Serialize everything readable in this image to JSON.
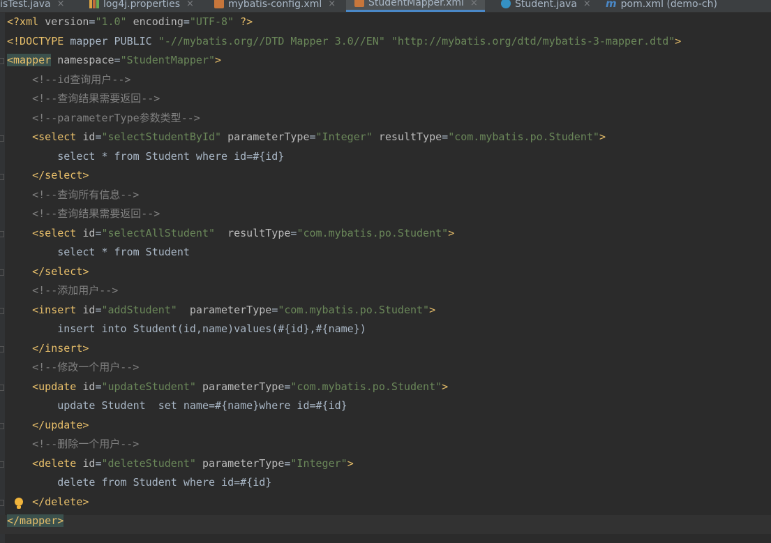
{
  "tabs": [
    {
      "label": "atisTest.java",
      "icon": "java-class-icon",
      "active": false
    },
    {
      "label": "log4j.properties",
      "icon": "properties-file-icon",
      "active": false
    },
    {
      "label": "mybatis-config.xml",
      "icon": "xml-file-icon",
      "active": false
    },
    {
      "label": "StudentMapper.xml",
      "icon": "xml-file-icon",
      "active": true
    },
    {
      "label": "Student.java",
      "icon": "java-class-icon",
      "active": false
    },
    {
      "label": "pom.xml (demo-ch)",
      "icon": "maven-icon",
      "active": false
    }
  ],
  "tab_close_glyph": "×",
  "colors": {
    "background": "#2b2b2b",
    "tag": "#e8bf6a",
    "attribute": "#bababa",
    "string": "#6a8759",
    "comment": "#808080",
    "text": "#a9b7c6",
    "matched_tag_highlight": "#3b514d"
  },
  "editor": {
    "lines": [
      [
        {
          "t": "<?xml ",
          "c": "pi"
        },
        {
          "t": "version",
          "c": "attr"
        },
        {
          "t": "=",
          "c": "text"
        },
        {
          "t": "\"1.0\"",
          "c": "val"
        },
        {
          "t": " ",
          "c": "text"
        },
        {
          "t": "encoding",
          "c": "attr"
        },
        {
          "t": "=",
          "c": "text"
        },
        {
          "t": "\"UTF-8\"",
          "c": "val"
        },
        {
          "t": " ?>",
          "c": "pi"
        }
      ],
      [
        {
          "t": "<!DOCTYPE ",
          "c": "doctype"
        },
        {
          "t": "mapper PUBLIC ",
          "c": "text"
        },
        {
          "t": "\"-//mybatis.org//DTD Mapper 3.0//EN\"",
          "c": "val"
        },
        {
          "t": " ",
          "c": "text"
        },
        {
          "t": "\"http://mybatis.org/dtd/mybatis-3-mapper.dtd\"",
          "c": "val"
        },
        {
          "t": ">",
          "c": "doctype"
        }
      ],
      [
        {
          "t": "<mapper",
          "c": "tag",
          "hl": true
        },
        {
          "t": " ",
          "c": "text"
        },
        {
          "t": "namespace",
          "c": "attr"
        },
        {
          "t": "=",
          "c": "text"
        },
        {
          "t": "\"StudentMapper\"",
          "c": "val"
        },
        {
          "t": ">",
          "c": "tag"
        }
      ],
      [
        {
          "t": "    <!--id查询用户-->",
          "c": "comment"
        }
      ],
      [
        {
          "t": "    <!--查询结果需要返回-->",
          "c": "comment"
        }
      ],
      [
        {
          "t": "    <!--parameterType参数类型-->",
          "c": "comment"
        }
      ],
      [
        {
          "t": "    ",
          "c": "text"
        },
        {
          "t": "<select",
          "c": "tag"
        },
        {
          "t": " ",
          "c": "text"
        },
        {
          "t": "id",
          "c": "attr"
        },
        {
          "t": "=",
          "c": "text"
        },
        {
          "t": "\"selectStudentById\"",
          "c": "val"
        },
        {
          "t": " ",
          "c": "text"
        },
        {
          "t": "parameterType",
          "c": "attr"
        },
        {
          "t": "=",
          "c": "text"
        },
        {
          "t": "\"Integer\"",
          "c": "val"
        },
        {
          "t": " ",
          "c": "text"
        },
        {
          "t": "resultType",
          "c": "attr"
        },
        {
          "t": "=",
          "c": "text"
        },
        {
          "t": "\"com.mybatis.po.Student\"",
          "c": "val"
        },
        {
          "t": ">",
          "c": "tag"
        }
      ],
      [
        {
          "t": "        select * from Student where id=#{id}",
          "c": "text"
        }
      ],
      [
        {
          "t": "    ",
          "c": "text"
        },
        {
          "t": "</select>",
          "c": "tag"
        }
      ],
      [
        {
          "t": "    <!--查询所有信息-->",
          "c": "comment"
        }
      ],
      [
        {
          "t": "    <!--查询结果需要返回-->",
          "c": "comment"
        }
      ],
      [
        {
          "t": "    ",
          "c": "text"
        },
        {
          "t": "<select",
          "c": "tag"
        },
        {
          "t": " ",
          "c": "text"
        },
        {
          "t": "id",
          "c": "attr"
        },
        {
          "t": "=",
          "c": "text"
        },
        {
          "t": "\"selectAllStudent\"",
          "c": "val"
        },
        {
          "t": "  ",
          "c": "text"
        },
        {
          "t": "resultType",
          "c": "attr"
        },
        {
          "t": "=",
          "c": "text"
        },
        {
          "t": "\"com.mybatis.po.Student\"",
          "c": "val"
        },
        {
          "t": ">",
          "c": "tag"
        }
      ],
      [
        {
          "t": "        select * from Student",
          "c": "text"
        }
      ],
      [
        {
          "t": "    ",
          "c": "text"
        },
        {
          "t": "</select>",
          "c": "tag"
        }
      ],
      [
        {
          "t": "    <!--添加用户-->",
          "c": "comment"
        }
      ],
      [
        {
          "t": "    ",
          "c": "text"
        },
        {
          "t": "<insert",
          "c": "tag"
        },
        {
          "t": " ",
          "c": "text"
        },
        {
          "t": "id",
          "c": "attr"
        },
        {
          "t": "=",
          "c": "text"
        },
        {
          "t": "\"addStudent\"",
          "c": "val"
        },
        {
          "t": "  ",
          "c": "text"
        },
        {
          "t": "parameterType",
          "c": "attr"
        },
        {
          "t": "=",
          "c": "text"
        },
        {
          "t": "\"com.mybatis.po.Student\"",
          "c": "val"
        },
        {
          "t": ">",
          "c": "tag"
        }
      ],
      [
        {
          "t": "        insert into Student(id,name)values(#{id},#{name})",
          "c": "text"
        }
      ],
      [
        {
          "t": "    ",
          "c": "text"
        },
        {
          "t": "</insert>",
          "c": "tag"
        }
      ],
      [
        {
          "t": "    <!--修改一个用户-->",
          "c": "comment"
        }
      ],
      [
        {
          "t": "    ",
          "c": "text"
        },
        {
          "t": "<update",
          "c": "tag"
        },
        {
          "t": " ",
          "c": "text"
        },
        {
          "t": "id",
          "c": "attr"
        },
        {
          "t": "=",
          "c": "text"
        },
        {
          "t": "\"updateStudent\"",
          "c": "val"
        },
        {
          "t": " ",
          "c": "text"
        },
        {
          "t": "parameterType",
          "c": "attr"
        },
        {
          "t": "=",
          "c": "text"
        },
        {
          "t": "\"com.mybatis.po.Student\"",
          "c": "val"
        },
        {
          "t": ">",
          "c": "tag"
        }
      ],
      [
        {
          "t": "        update Student  set name=#{name}where id=#{id}",
          "c": "text"
        }
      ],
      [
        {
          "t": "    ",
          "c": "text"
        },
        {
          "t": "</update>",
          "c": "tag"
        }
      ],
      [
        {
          "t": "    <!--删除一个用户-->",
          "c": "comment"
        }
      ],
      [
        {
          "t": "    ",
          "c": "text"
        },
        {
          "t": "<delete",
          "c": "tag"
        },
        {
          "t": " ",
          "c": "text"
        },
        {
          "t": "id",
          "c": "attr"
        },
        {
          "t": "=",
          "c": "text"
        },
        {
          "t": "\"deleteStudent\"",
          "c": "val"
        },
        {
          "t": " ",
          "c": "text"
        },
        {
          "t": "parameterType",
          "c": "attr"
        },
        {
          "t": "=",
          "c": "text"
        },
        {
          "t": "\"Integer\"",
          "c": "val"
        },
        {
          "t": ">",
          "c": "tag"
        }
      ],
      [
        {
          "t": "        delete from Student where id=#{id}",
          "c": "text"
        }
      ],
      [
        {
          "t": "    ",
          "c": "text"
        },
        {
          "t": "</delete>",
          "c": "tag"
        }
      ],
      [
        {
          "t": "</mapper>",
          "c": "tag",
          "hl": true
        }
      ]
    ]
  }
}
